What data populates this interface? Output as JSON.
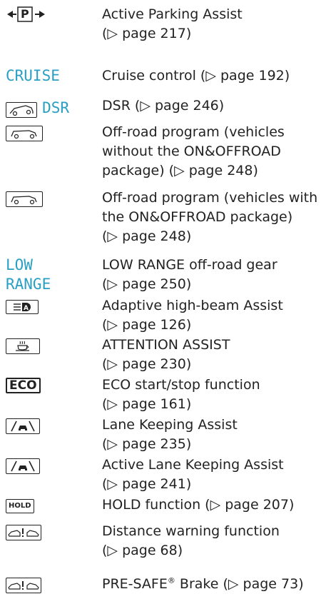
{
  "entries": [
    {
      "icon": "parking-arrows-icon",
      "icon_text": "P",
      "lines": [
        "Active Parking Assist",
        "(▷ page 217)"
      ]
    },
    {
      "icon": "cruise-text-icon",
      "icon_text": "CRUISE",
      "lines": [
        "Cruise control (▷ page 192)"
      ]
    },
    {
      "icon": "dsr-icon",
      "icon_text": "DSR",
      "lines": [
        "DSR (▷ page 246)"
      ]
    },
    {
      "icon": "offroad-vehicle-icon",
      "lines": [
        "Off-road program (vehicles",
        "without the ON&OFFROAD",
        "package) (▷ page 248)"
      ]
    },
    {
      "icon": "offroad-vehicle-icon",
      "lines": [
        "Off-road program (vehicles with",
        "the ON&OFFROAD package)",
        "(▷ page 248)"
      ]
    },
    {
      "icon": "low-range-text-icon",
      "icon_text": [
        "LOW",
        "RANGE"
      ],
      "lines": [
        "LOW RANGE off-road gear",
        "(▷ page 250)"
      ]
    },
    {
      "icon": "high-beam-assist-icon",
      "icon_text": "A",
      "lines": [
        "Adaptive high-beam Assist",
        "(▷ page 126)"
      ]
    },
    {
      "icon": "coffee-cup-icon",
      "lines": [
        "ATTENTION ASSIST",
        "(▷ page 230)"
      ]
    },
    {
      "icon": "eco-icon",
      "icon_text": "ECO",
      "lines": [
        "ECO start/stop function",
        "(▷ page 161)"
      ]
    },
    {
      "icon": "lane-keeping-icon",
      "lines": [
        "Lane Keeping Assist",
        "(▷ page 235)"
      ]
    },
    {
      "icon": "lane-keeping-icon",
      "lines": [
        "Active Lane Keeping Assist",
        "(▷ page 241)"
      ]
    },
    {
      "icon": "hold-icon",
      "icon_text": "HOLD",
      "lines": [
        "HOLD function (▷ page 207)"
      ]
    },
    {
      "icon": "distance-warning-icon",
      "lines": [
        "Distance warning function",
        "(▷ page 68)"
      ]
    },
    {
      "icon": "distance-warning-icon",
      "lines_rich": {
        "before": "PRE-SAFE",
        "sup": "®",
        "after": " Brake (▷ page 73)"
      }
    }
  ]
}
